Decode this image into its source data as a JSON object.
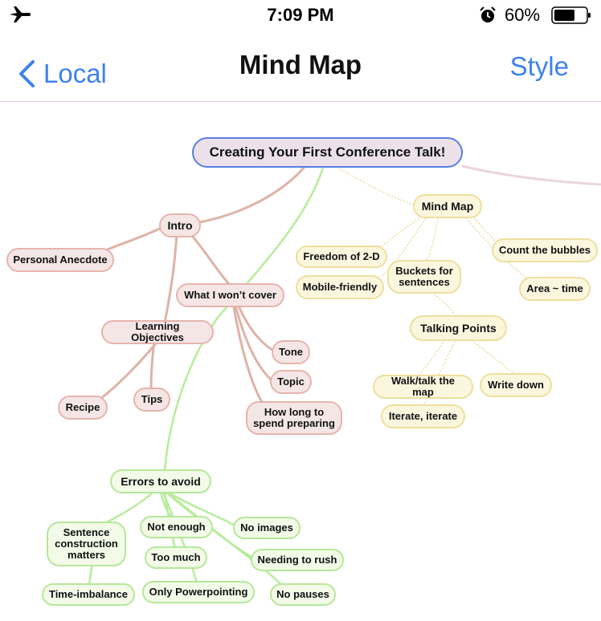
{
  "status": {
    "time": "7:09 PM",
    "battery_percent": "60%",
    "icons": [
      "airplane-icon",
      "alarm-icon",
      "battery-icon"
    ]
  },
  "nav": {
    "back_label": "Local",
    "title": "Mind Map",
    "right_label": "Style"
  },
  "colors": {
    "accent": "#3d82ee",
    "root_border": "#5a7ee5",
    "red_branch": "#e5b4ae",
    "yellow_branch": "#eddf9e",
    "green_branch": "#b6e79a"
  },
  "map": {
    "root": "Creating Your First Conference Talk!",
    "intro": {
      "label": "Intro",
      "personal_anecdote": "Personal Anecdote",
      "what_i_wont_cover": "What I won’t cover",
      "tone": "Tone",
      "topic": "Topic",
      "how_long": "How long to spend preparing",
      "learning_objectives": "Learning Objectives",
      "recipe": "Recipe",
      "tips": "Tips"
    },
    "mind_map": {
      "label": "Mind Map",
      "freedom": "Freedom of 2-D",
      "mobile": "Mobile-friendly",
      "buckets": "Buckets for sentences",
      "count": "Count the bubbles",
      "area": "Area ~ time",
      "talking_points": "Talking Points",
      "walk": "Walk/talk the map",
      "write": "Write down",
      "iterate": "Iterate, iterate"
    },
    "errors": {
      "label": "Errors to avoid",
      "sentence": "Sentence construction matters",
      "not_enough": "Not enough",
      "no_images": "No images",
      "too_much": "Too much",
      "needing": "Needing to rush",
      "time_imbalance": "Time-imbalance",
      "only_pp": "Only Powerpointing",
      "no_pauses": "No pauses"
    }
  }
}
